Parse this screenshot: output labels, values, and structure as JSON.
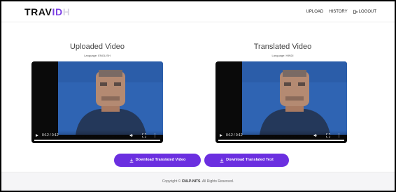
{
  "header": {
    "logo_main": "TRAV",
    "logo_accent": "ID",
    "logo_ghost": "H",
    "nav": {
      "upload": "UPLOAD",
      "history": "HISTORY",
      "logout": "LOGOUT"
    }
  },
  "panels": [
    {
      "title": "Uploaded Video",
      "language": "Language: ENGLISH",
      "time": "0:12 / 0:12",
      "progress_fraction": 1.0
    },
    {
      "title": "Translated Video",
      "language": "Language: HINDI",
      "time": "0:12 / 0:12",
      "progress_fraction": 1.0
    }
  ],
  "actions": {
    "download_video": "Download Translated Video",
    "download_text": "Download Translated Text"
  },
  "footer": {
    "prefix": "Copyright ©",
    "brand": "CNLP-NITS",
    "suffix": ". All Rights Reserved."
  },
  "colors": {
    "accent": "#6b2fe0",
    "logo_accent": "#7b3fe4"
  },
  "icons": {
    "logout": "logout-icon",
    "download": "download-icon",
    "play": "play-icon",
    "volume": "volume-icon",
    "fullscreen": "fullscreen-icon",
    "more": "more-vertical-icon"
  }
}
